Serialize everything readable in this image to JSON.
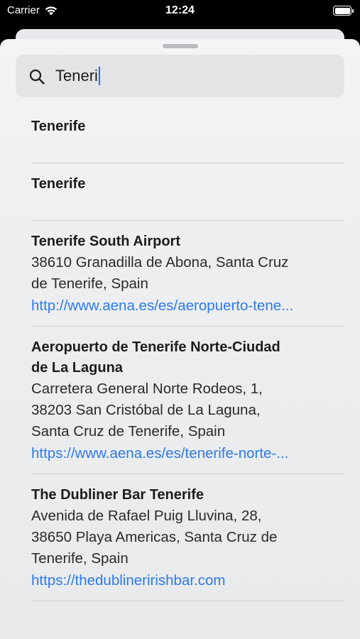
{
  "status_bar": {
    "carrier": "Carrier",
    "time": "12:24",
    "battery_level": 1.0
  },
  "search": {
    "query": "Teneri",
    "icon": "search-icon"
  },
  "results": [
    {
      "title": "Tenerife"
    },
    {
      "title": "Tenerife"
    },
    {
      "title": "Tenerife South Airport",
      "address_lines": [
        "38610 Granadilla de Abona, Santa Cruz",
        "de Tenerife, Spain"
      ],
      "url": "http://www.aena.es/es/aeropuerto-tene..."
    },
    {
      "title_lines": [
        "Aeropuerto de Tenerife Norte-Ciudad",
        "de La Laguna"
      ],
      "address_lines": [
        "Carretera General Norte Rodeos, 1,",
        "38203 San Cristóbal de La Laguna,",
        "Santa Cruz de Tenerife, Spain"
      ],
      "url": "https://www.aena.es/es/tenerife-norte-..."
    },
    {
      "title": "The Dubliner Bar Tenerife",
      "address_lines": [
        "Avenida de Rafael Puig Lluvina, 28,",
        "38650 Playa Americas, Santa Cruz de",
        "Tenerife, Spain"
      ],
      "url": "https://thedublineririshbar.com"
    }
  ],
  "colors": {
    "link": "#2f7be6",
    "caret": "#1a73e8"
  }
}
